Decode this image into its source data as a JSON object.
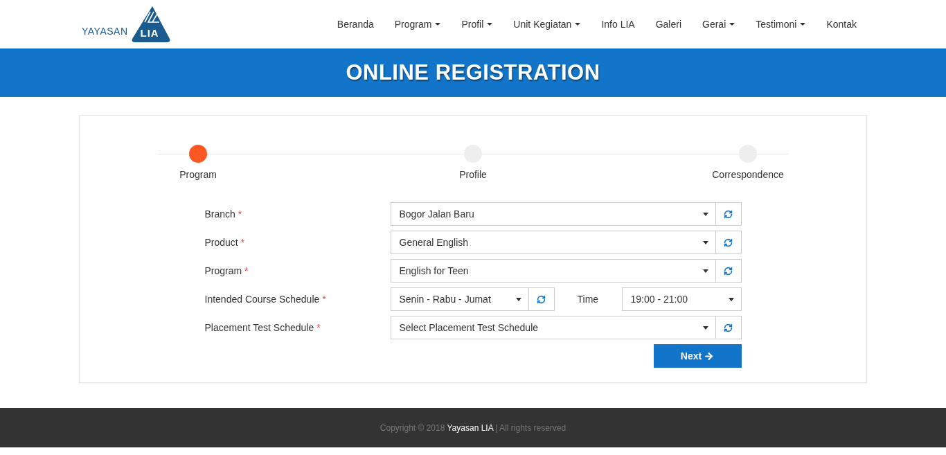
{
  "logo": {
    "word": "YAYASAN",
    "mark": "LIA"
  },
  "nav": [
    {
      "label": "Beranda",
      "dropdown": false
    },
    {
      "label": "Program",
      "dropdown": true
    },
    {
      "label": "Profil",
      "dropdown": true
    },
    {
      "label": "Unit Kegiatan",
      "dropdown": true
    },
    {
      "label": "Info LIA",
      "dropdown": false
    },
    {
      "label": "Galeri",
      "dropdown": false
    },
    {
      "label": "Gerai",
      "dropdown": true
    },
    {
      "label": "Testimoni",
      "dropdown": true
    },
    {
      "label": "Kontak",
      "dropdown": false
    }
  ],
  "banner": {
    "title": "ONLINE REGISTRATION"
  },
  "steps": [
    {
      "label": "Program",
      "selected": true
    },
    {
      "label": "Profile",
      "selected": false
    },
    {
      "label": "Correspondence",
      "selected": false
    }
  ],
  "fields": [
    {
      "kind": "select",
      "label": "Branch",
      "required_mark": "*",
      "value": "Bogor Jalan Baru"
    },
    {
      "kind": "select",
      "label": "Product",
      "required_mark": "*",
      "value": "General English"
    },
    {
      "kind": "select",
      "label": "Program",
      "required_mark": "*",
      "value": "English for Teen"
    },
    {
      "kind": "schedule",
      "label": "Intended Course Schedule",
      "required_mark": "*",
      "value": "Senin - Rabu - Jumat",
      "time_label": "Time",
      "time_value": "19:00 - 21:00"
    },
    {
      "kind": "select",
      "label": "Placement Test Schedule",
      "required_mark": "*",
      "placeholder": "Select Placement Test Schedule"
    }
  ],
  "next_button": "Next",
  "footer": "Copyright © 2018 **Yayasan LIA** | All rights reserved"
}
